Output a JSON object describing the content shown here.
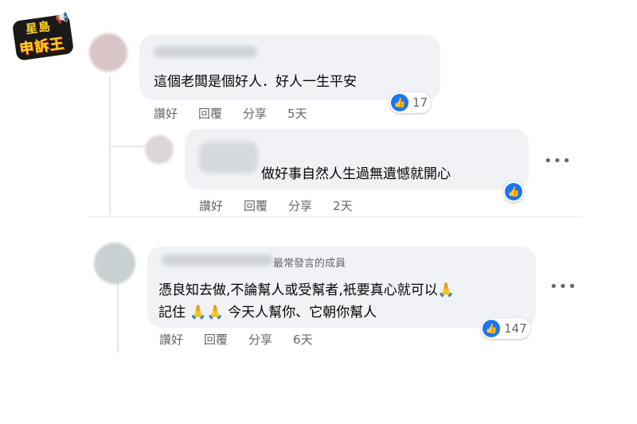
{
  "logo": {
    "line1": "星島",
    "line2": "申訴王"
  },
  "comments": [
    {
      "text": "這個老闆是個好人．好人一生平安",
      "actions": {
        "like": "讚好",
        "reply": "回覆",
        "share": "分享",
        "time": "5天"
      },
      "reactions": "17"
    },
    {
      "text": "做好事自然人生過無遺憾就開心",
      "actions": {
        "like": "讚好",
        "reply": "回覆",
        "share": "分享",
        "time": "2天"
      },
      "reactions": ""
    },
    {
      "badge": "最常發言的成員",
      "line1": "憑良知去做,不論幫人或受幫者,衹要真心就可以🙏",
      "line2": "記住 🙏🙏 今天人幫你、它朝你幫人",
      "actions": {
        "like": "讚好",
        "reply": "回覆",
        "share": "分享",
        "time": "6天"
      },
      "reactions": "147"
    }
  ],
  "icons": {
    "like": "thumbs-up-icon",
    "more": "more-options-icon"
  },
  "colors": {
    "like_blue": "#1877f2",
    "bubble": "#f0f2f5",
    "action_text": "#65676b"
  }
}
